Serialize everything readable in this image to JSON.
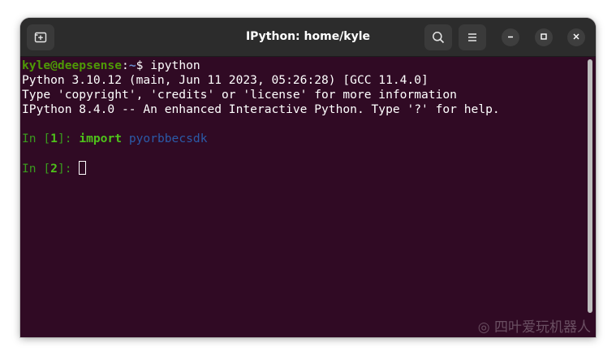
{
  "window": {
    "title": "IPython: home/kyle"
  },
  "toolbar": {
    "new_tab_icon": "new-tab-icon",
    "search_icon": "search-icon",
    "menu_icon": "hamburger-menu-icon",
    "minimize_icon": "minimize-icon",
    "maximize_icon": "maximize-icon",
    "close_icon": "close-icon"
  },
  "terminal": {
    "prompt_user": "kyle@deepsense",
    "prompt_sep": ":",
    "prompt_path": "~",
    "prompt_dollar": "$",
    "prompt_command": " ipython",
    "banner_line1": "Python 3.10.12 (main, Jun 11 2023, 05:26:28) [GCC 11.4.0]",
    "banner_line2": "Type 'copyright', 'credits' or 'license' for more information",
    "banner_line3": "IPython 8.4.0 -- An enhanced Interactive Python. Type '?' for help.",
    "cells": [
      {
        "in_label": "In [",
        "number": "1",
        "in_close": "]: ",
        "keyword": "import",
        "module": "pyorbbecsdk"
      },
      {
        "in_label": "In [",
        "number": "2",
        "in_close": "]: "
      }
    ]
  },
  "watermark": {
    "text": "◎ 四叶爱玩机器人"
  },
  "colors": {
    "terminal_bg": "#300a24",
    "titlebar_bg": "#2c2c2c",
    "prompt_green": "#4e9a06",
    "prompt_blue": "#6a8fd0",
    "keyword_green": "#3a9a1e",
    "module_blue": "#2b5aa8"
  }
}
